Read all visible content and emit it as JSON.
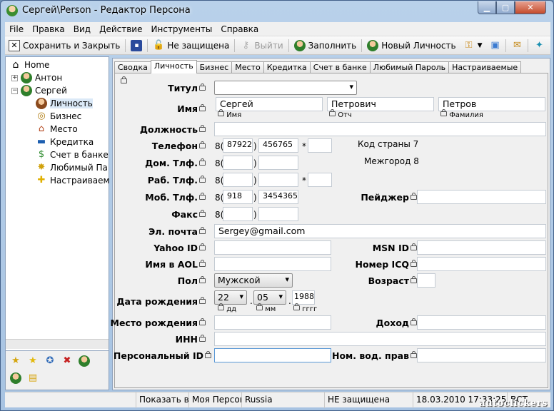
{
  "window": {
    "title": "Сергей\\Person - Редактор Персона"
  },
  "menu": [
    "File",
    "Правка",
    "Вид",
    "Действие",
    "Инструменты",
    "Справка"
  ],
  "toolbar": {
    "save_close": "Сохранить и Закрыть",
    "not_protected": "Не защищена",
    "exit": "Выйти",
    "fill": "Заполнить",
    "new_person": "Новый Личность"
  },
  "tree": {
    "home": "Home",
    "anton": "Антон",
    "sergey": "Сергей",
    "items": [
      "Личность",
      "Бизнес",
      "Место",
      "Кредитка",
      "Счет в банке",
      "Любимый Па",
      "Настраиваем"
    ]
  },
  "tabs": [
    "Сводка",
    "Личность",
    "Бизнес",
    "Место",
    "Кредитка",
    "Счет в банке",
    "Любимый Пароль",
    "Настраиваемые"
  ],
  "form": {
    "title_label": "Титул",
    "name_label": "Имя",
    "first_name": "Сергей",
    "middle_name": "Петрович",
    "last_name": "Петров",
    "sub_first": "Имя",
    "sub_middle": "Отч",
    "sub_last": "Фамилия",
    "position_label": "Должность",
    "phone_label": "Телефон",
    "phone_prefix": "8(",
    "phone_area": "87922",
    "phone_number": "456765",
    "ext_mark": "*",
    "country_code": "Код страны 7",
    "intercity": "Межгород 8",
    "home_phone_label": "Дом. Тлф.",
    "work_phone_label": "Раб. Тлф.",
    "mobile_label": "Моб. Тлф.",
    "mobile_area": "918",
    "mobile_number": "3454365",
    "pager_label": "Пейджер",
    "fax_label": "Факс",
    "email_label": "Эл. почта",
    "email": "Sergey@gmail.com",
    "yahoo_label": "Yahoo ID",
    "msn_label": "MSN ID",
    "aol_label": "Имя в AOL",
    "icq_label": "Номер ICQ",
    "gender_label": "Пол",
    "gender": "Мужской",
    "age_label": "Возраст",
    "dob_label": "Дата рождения",
    "dob_day": "22",
    "dob_month": "05",
    "dob_year": "1988",
    "dob_sub_day": "дд",
    "dob_sub_month": "мм",
    "dob_sub_year": "гггг",
    "birthplace_label": "Место рождения",
    "income_label": "Доход",
    "inn_label": "ИНН",
    "personal_id_label": "Персональный ID",
    "license_label": "Ном. вод. прав",
    "close_paren": ")",
    "dot": "."
  },
  "status": {
    "show": "Показать вс",
    "my_person": "Моя Персон",
    "country": "Russia",
    "protection": "НЕ защищена",
    "datetime": "18.03.2010 17:33:25",
    "mode": "ВСТ"
  },
  "watermark": "autoclickers"
}
